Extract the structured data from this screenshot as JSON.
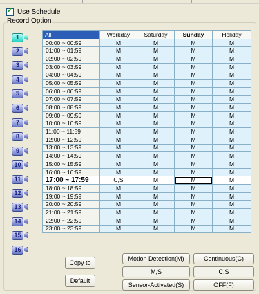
{
  "use_schedule": {
    "label": "Use Schedule",
    "checked": true
  },
  "record_option": {
    "title": "Record Option"
  },
  "cameras": [
    "1",
    "2",
    "3",
    "4",
    "5",
    "6",
    "7",
    "8",
    "9",
    "10",
    "11",
    "12",
    "13",
    "14",
    "15",
    "16"
  ],
  "active_camera": "1",
  "table": {
    "corner": "All",
    "columns": [
      "Workday",
      "Saturday",
      "Sunday",
      "Holiday"
    ],
    "rows": [
      {
        "time": "00:00 ~ 00:59",
        "cells": [
          "M",
          "M",
          "M",
          "M"
        ]
      },
      {
        "time": "01:00 ~ 01:59",
        "cells": [
          "M",
          "M",
          "M",
          "M"
        ]
      },
      {
        "time": "02:00 ~ 02:59",
        "cells": [
          "M",
          "M",
          "M",
          "M"
        ]
      },
      {
        "time": "03:00 ~ 03:59",
        "cells": [
          "M",
          "M",
          "M",
          "M"
        ]
      },
      {
        "time": "04:00 ~ 04:59",
        "cells": [
          "M",
          "M",
          "M",
          "M"
        ]
      },
      {
        "time": "05:00 ~ 05:59",
        "cells": [
          "M",
          "M",
          "M",
          "M"
        ]
      },
      {
        "time": "06:00 ~ 06:59",
        "cells": [
          "M",
          "M",
          "M",
          "M"
        ]
      },
      {
        "time": "07:00 ~ 07:59",
        "cells": [
          "M",
          "M",
          "M",
          "M"
        ]
      },
      {
        "time": "08:00 ~ 08:59",
        "cells": [
          "M",
          "M",
          "M",
          "M"
        ]
      },
      {
        "time": "09:00 ~ 09:59",
        "cells": [
          "M",
          "M",
          "M",
          "M"
        ]
      },
      {
        "time": "10:00 ~ 10:59",
        "cells": [
          "M",
          "M",
          "M",
          "M"
        ]
      },
      {
        "time": "11:00 ~ 11:59",
        "cells": [
          "M",
          "M",
          "M",
          "M"
        ]
      },
      {
        "time": "12:00 ~ 12:59",
        "cells": [
          "M",
          "M",
          "M",
          "M"
        ]
      },
      {
        "time": "13:00 ~ 13:59",
        "cells": [
          "M",
          "M",
          "M",
          "M"
        ]
      },
      {
        "time": "14:00 ~ 14:59",
        "cells": [
          "M",
          "M",
          "M",
          "M"
        ]
      },
      {
        "time": "15:00 ~ 15:59",
        "cells": [
          "M",
          "M",
          "M",
          "M"
        ]
      },
      {
        "time": "16:00 ~ 16:59",
        "cells": [
          "M",
          "M",
          "M",
          "M"
        ]
      },
      {
        "time": "17:00 ~ 17:59",
        "cells": [
          "C,S",
          "M",
          "M",
          "M"
        ],
        "highlight": true
      },
      {
        "time": "18:00 ~ 18:59",
        "cells": [
          "M",
          "M",
          "M",
          "M"
        ]
      },
      {
        "time": "19:00 ~ 19:59",
        "cells": [
          "M",
          "M",
          "M",
          "M"
        ]
      },
      {
        "time": "20:00 ~ 20:59",
        "cells": [
          "M",
          "M",
          "M",
          "M"
        ]
      },
      {
        "time": "21:00 ~ 21:59",
        "cells": [
          "M",
          "M",
          "M",
          "M"
        ]
      },
      {
        "time": "22:00 ~ 22:59",
        "cells": [
          "M",
          "M",
          "M",
          "M"
        ]
      },
      {
        "time": "23:00 ~ 23:59",
        "cells": [
          "M",
          "M",
          "M",
          "M"
        ]
      }
    ]
  },
  "buttons": {
    "copy_to": "Copy to",
    "default": "Default",
    "motion_detection": "Motion Detection(M)",
    "continuous": "Continuous(C)",
    "ms": "M,S",
    "cs": "C,S",
    "sensor_activated": "Sensor-Activated(S)",
    "off": "OFF(F)"
  }
}
